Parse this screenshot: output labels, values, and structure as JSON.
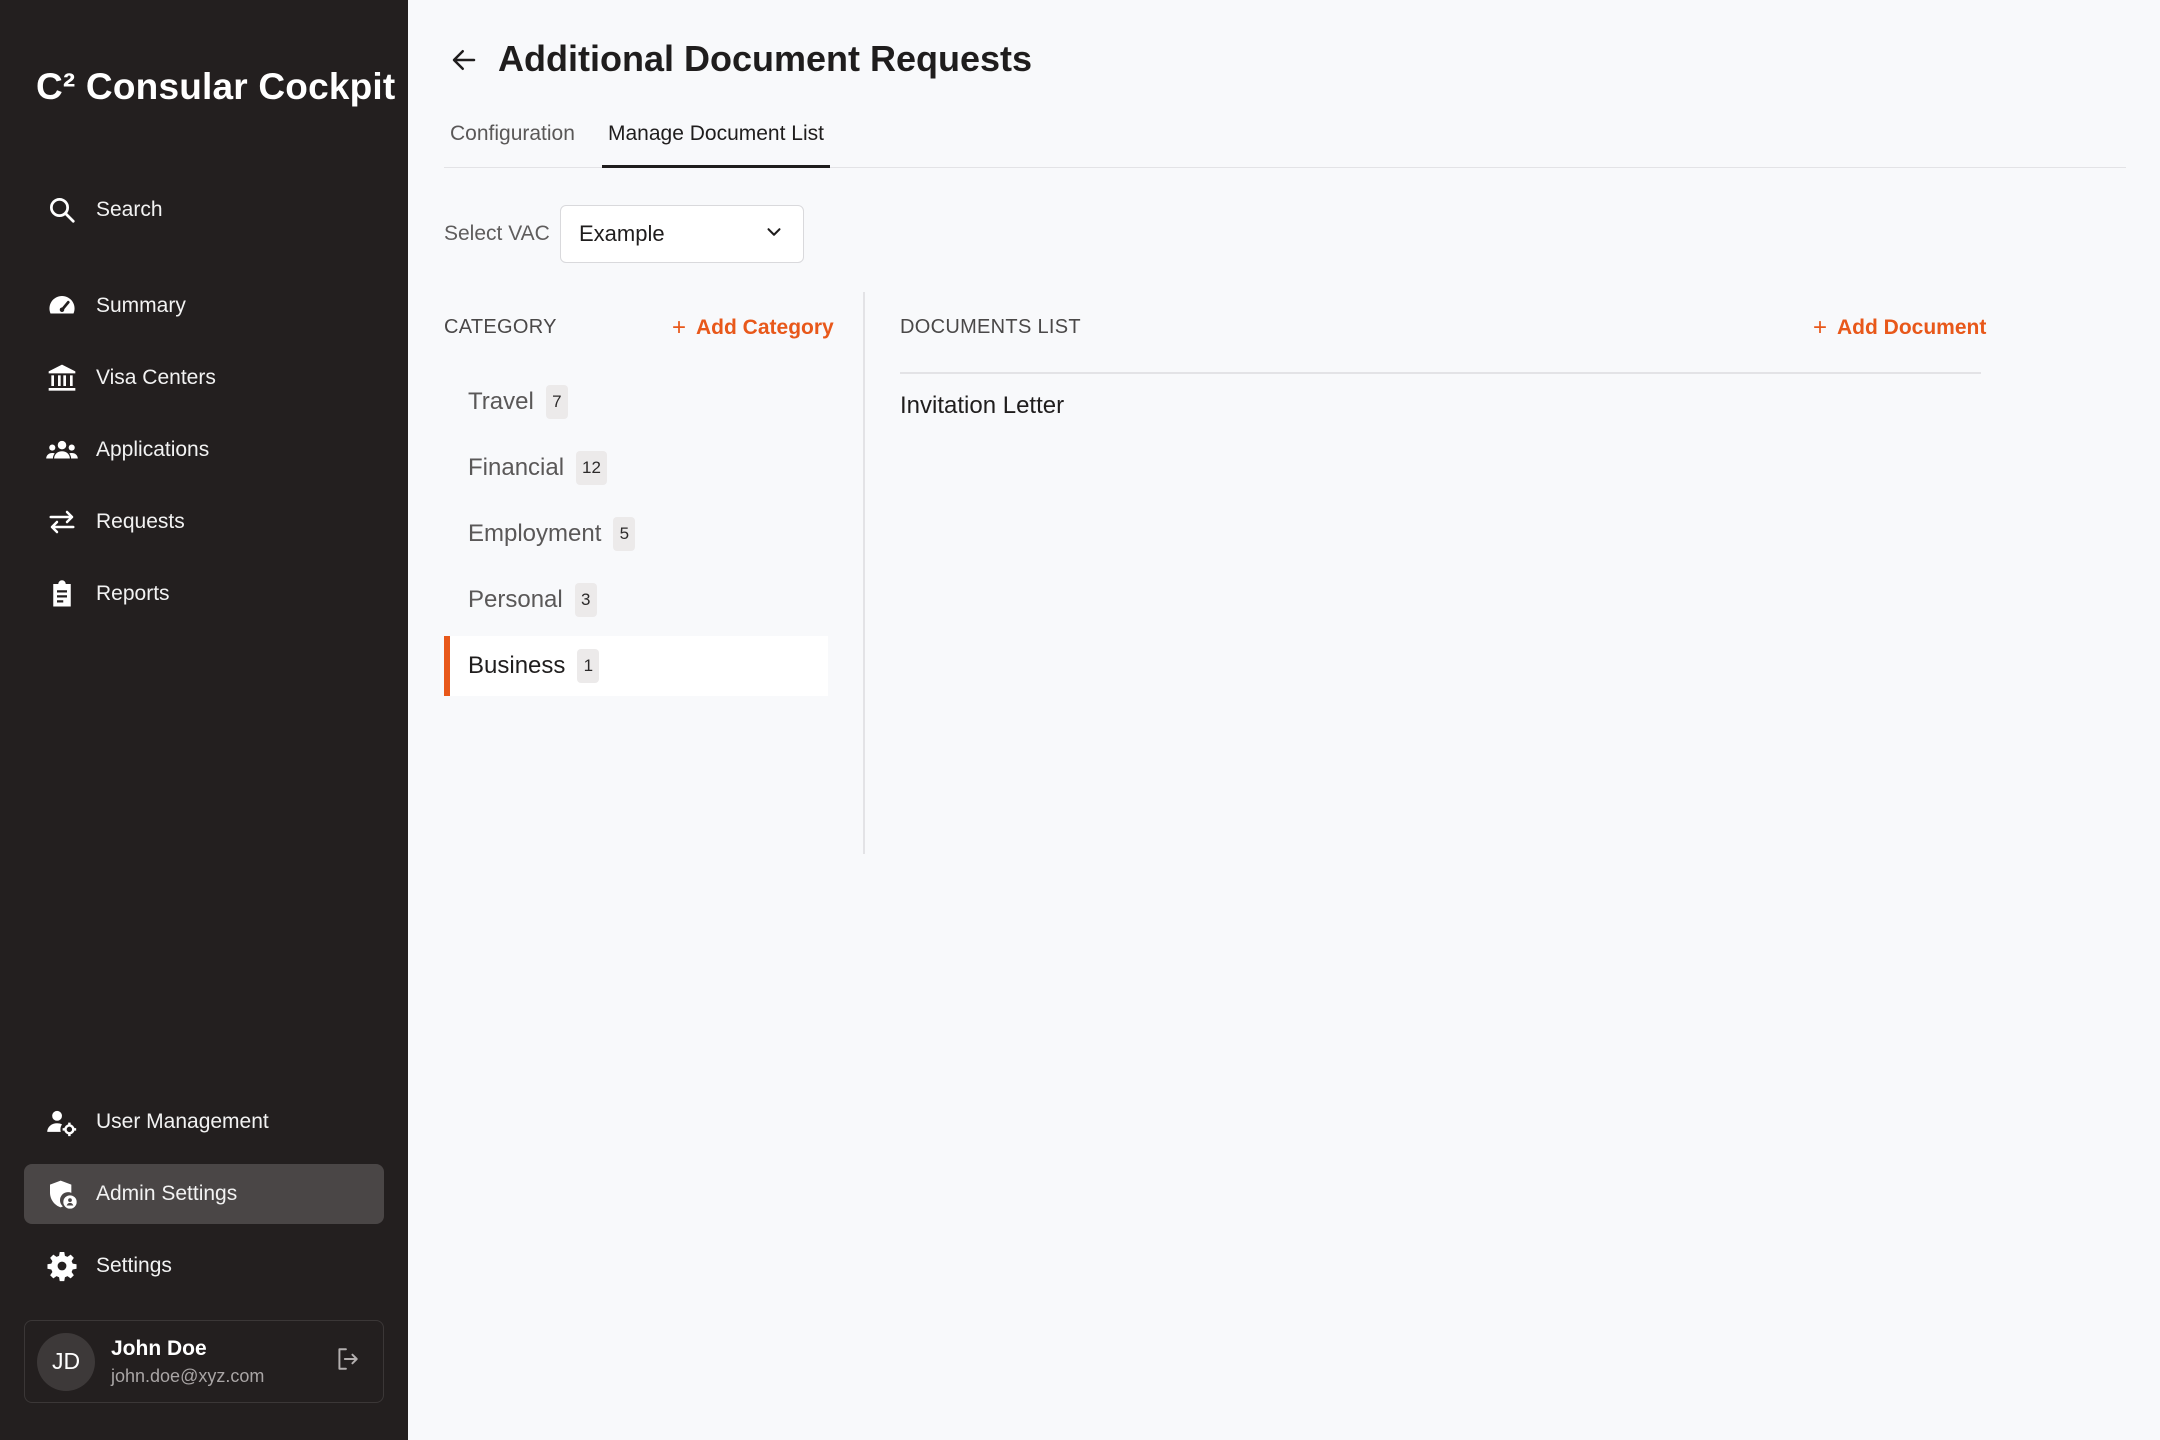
{
  "sidebar": {
    "brand": "C² Consular Cockpit",
    "nav": [
      {
        "label": "Search",
        "icon": "search-icon"
      },
      {
        "label": "Summary",
        "icon": "gauge-icon"
      },
      {
        "label": "Visa Centers",
        "icon": "bank-icon"
      },
      {
        "label": "Applications",
        "icon": "people-group-icon"
      },
      {
        "label": "Requests",
        "icon": "swap-arrows-icon"
      },
      {
        "label": "Reports",
        "icon": "clipboard-icon"
      }
    ],
    "bottom_nav": [
      {
        "label": "User Management",
        "icon": "user-gear-icon"
      },
      {
        "label": "Admin Settings",
        "icon": "shield-user-icon",
        "active": true
      },
      {
        "label": "Settings",
        "icon": "gear-icon"
      }
    ],
    "user": {
      "initials": "JD",
      "name": "John Doe",
      "email": "john.doe@xyz.com",
      "logout_icon": "logout-icon"
    }
  },
  "header": {
    "back_icon": "arrow-left-icon",
    "title": "Additional Document Requests",
    "tabs": [
      {
        "label": "Configuration",
        "active": false
      },
      {
        "label": "Manage Document List",
        "active": true
      }
    ]
  },
  "vac": {
    "label": "Select VAC",
    "selected": "Example",
    "icon": "chevron-down-icon"
  },
  "categories": {
    "title": "CATEGORY",
    "add_label": "Add Category",
    "items": [
      {
        "label": "Travel",
        "count": "7"
      },
      {
        "label": "Financial",
        "count": "12"
      },
      {
        "label": "Employment",
        "count": "5"
      },
      {
        "label": "Personal",
        "count": "3"
      },
      {
        "label": "Business",
        "count": "1",
        "active": true
      }
    ]
  },
  "documents": {
    "title": "DOCUMENTS LIST",
    "add_label": "Add Document",
    "items": [
      "Invitation Letter"
    ]
  },
  "colors": {
    "sidebar_bg": "#231f1f",
    "accent": "#e8581a",
    "active_nav_bg": "#4a4646",
    "page_bg": "#f8f9fb"
  }
}
